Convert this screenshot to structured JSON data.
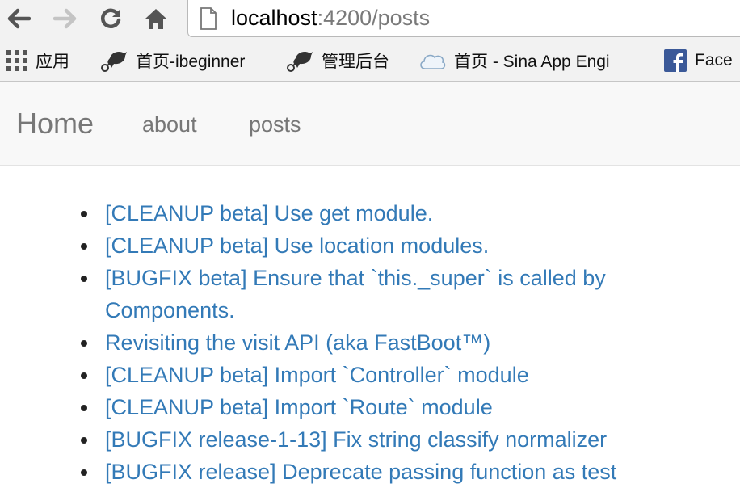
{
  "browser": {
    "url_host": "localhost",
    "url_rest": ":4200/posts"
  },
  "bookmarks": [
    {
      "label": "应用",
      "icon": "apps-grid-icon"
    },
    {
      "label": "首页-ibeginner",
      "icon": "bird-icon"
    },
    {
      "label": "管理后台",
      "icon": "bird-icon"
    },
    {
      "label": "首页 - Sina App Engi",
      "icon": "cloud-icon"
    },
    {
      "label": "Face",
      "icon": "facebook-icon"
    }
  ],
  "navbar": {
    "brand": "Home",
    "links": [
      "about",
      "posts"
    ]
  },
  "posts": [
    "[CLEANUP beta] Use get module.",
    "[CLEANUP beta] Use location modules.",
    "[BUGFIX beta] Ensure that `this._super` is called by Components.",
    "Revisiting the visit API (aka FastBoot™)",
    "[CLEANUP beta] Import `Controller` module",
    "[CLEANUP beta] Import `Route` module",
    "[BUGFIX release-1-13] Fix string classify normalizer",
    "[BUGFIX release] Deprecate passing function as test"
  ],
  "colors": {
    "link": "#337ab7",
    "navbar_bg": "#f8f8f8",
    "navbar_text": "#777777",
    "facebook_blue": "#3b5998"
  }
}
